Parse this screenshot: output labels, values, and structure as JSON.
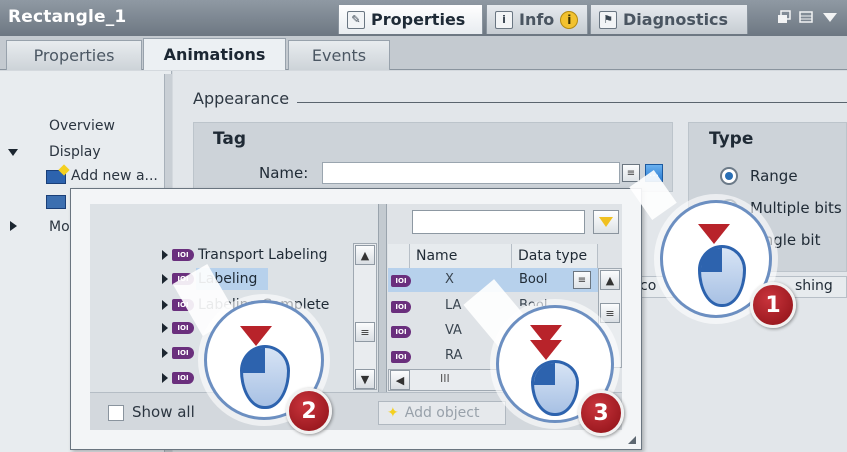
{
  "window": {
    "title": "Rectangle_1"
  },
  "panel_tabs": [
    {
      "label": "Properties",
      "icon": "properties-icon",
      "active": true
    },
    {
      "label": "Info",
      "icon": "info-icon",
      "badge": "i"
    },
    {
      "label": "Diagnostics",
      "icon": "diagnostics-icon"
    }
  ],
  "sub_tabs": [
    {
      "label": "Properties"
    },
    {
      "label": "Animations",
      "active": true
    },
    {
      "label": "Events"
    }
  ],
  "nav": {
    "overview": "Overview",
    "display": "Display",
    "add_new": "Add new a...",
    "movements": "Mo"
  },
  "appearance": {
    "title": "Appearance"
  },
  "tag": {
    "title": "Tag",
    "name_label": "Name:",
    "name_value": ""
  },
  "type": {
    "title": "Type",
    "options": [
      "Range",
      "Multiple bits",
      "Single bit"
    ],
    "selected": "Range"
  },
  "table_headers_right": {
    "col_a": "co",
    "col_b": "shing"
  },
  "popup": {
    "tree": [
      {
        "label": "Transport Labeling"
      },
      {
        "label": "Labeling",
        "selected": true
      },
      {
        "label": "Labeling Complete"
      },
      {
        "label": ""
      },
      {
        "label": ""
      }
    ],
    "filter_value": "",
    "columns": {
      "name": "Name",
      "data_type": "Data type"
    },
    "rows": [
      {
        "name": "X",
        "type": "Bool",
        "selected": true
      },
      {
        "name": "LA",
        "type": "Bool"
      },
      {
        "name": "VA",
        "type": ""
      },
      {
        "name": "RA",
        "type": ""
      }
    ],
    "show_all_label": "Show all",
    "add_object_label": "Add object",
    "hscroll_thumb": "III"
  },
  "callouts": [
    {
      "step": "1"
    },
    {
      "step": "2"
    },
    {
      "step": "3"
    }
  ],
  "colors": {
    "step_red": "#b8232a",
    "mouse_blue": "#2d63ae",
    "selection_blue": "#b7d1ec",
    "tag_icon_purple": "#6a2f7d"
  }
}
